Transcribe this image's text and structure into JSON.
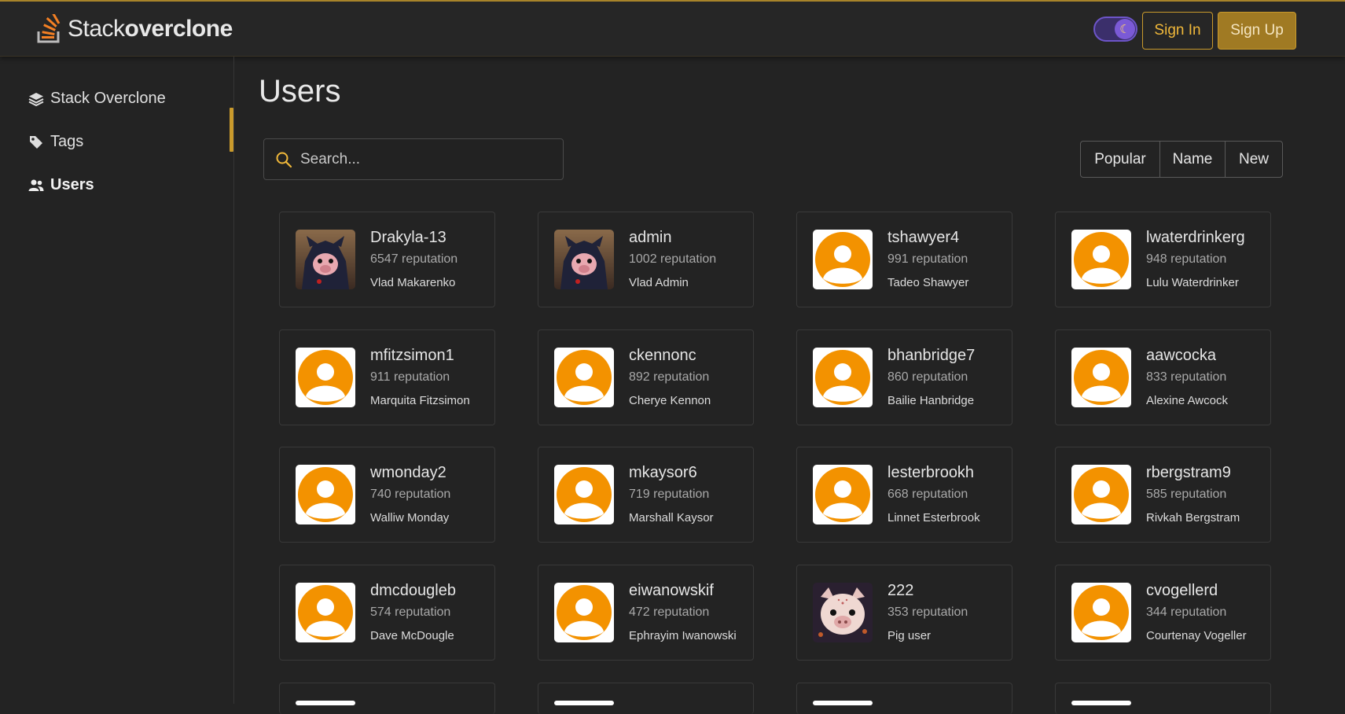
{
  "header": {
    "logo_light": "Stack",
    "logo_bold": "overclone",
    "theme_toggle_icon": "moon-icon",
    "sign_in": "Sign In",
    "sign_up": "Sign Up"
  },
  "sidebar": {
    "items": [
      {
        "label": "Stack Overclone",
        "icon": "layers-icon"
      },
      {
        "label": "Tags",
        "icon": "tags-icon"
      },
      {
        "label": "Users",
        "icon": "users-icon",
        "active": true
      }
    ]
  },
  "main": {
    "title": "Users",
    "search_placeholder": "Search...",
    "filters": [
      "Popular",
      "Name",
      "New"
    ]
  },
  "users": [
    {
      "username": "Drakyla-13",
      "reputation": "6547 reputation",
      "name": "Vlad Makarenko",
      "avatar": "hooded-pig"
    },
    {
      "username": "admin",
      "reputation": "1002 reputation",
      "name": "Vlad Admin",
      "avatar": "hooded-pig"
    },
    {
      "username": "tshawyer4",
      "reputation": "991 reputation",
      "name": "Tadeo Shawyer",
      "avatar": "default"
    },
    {
      "username": "lwaterdrinkerg",
      "reputation": "948 reputation",
      "name": "Lulu Waterdrinker",
      "avatar": "default"
    },
    {
      "username": "mfitzsimon1",
      "reputation": "911 reputation",
      "name": "Marquita Fitzsimon",
      "avatar": "default"
    },
    {
      "username": "ckennonc",
      "reputation": "892 reputation",
      "name": "Cherye Kennon",
      "avatar": "default"
    },
    {
      "username": "bhanbridge7",
      "reputation": "860 reputation",
      "name": "Bailie Hanbridge",
      "avatar": "default"
    },
    {
      "username": "aawcocka",
      "reputation": "833 reputation",
      "name": "Alexine Awcock",
      "avatar": "default"
    },
    {
      "username": "wmonday2",
      "reputation": "740 reputation",
      "name": "Walliw Monday",
      "avatar": "default"
    },
    {
      "username": "mkaysor6",
      "reputation": "719 reputation",
      "name": "Marshall Kaysor",
      "avatar": "default"
    },
    {
      "username": "lesterbrookh",
      "reputation": "668 reputation",
      "name": "Linnet Esterbrook",
      "avatar": "default"
    },
    {
      "username": "rbergstram9",
      "reputation": "585 reputation",
      "name": "Rivkah Bergstram",
      "avatar": "default"
    },
    {
      "username": "dmcdougleb",
      "reputation": "574 reputation",
      "name": "Dave McDougle",
      "avatar": "default"
    },
    {
      "username": "eiwanowskif",
      "reputation": "472 reputation",
      "name": "Ephrayim Iwanowski",
      "avatar": "default"
    },
    {
      "username": "222",
      "reputation": "353 reputation",
      "name": "Pig user",
      "avatar": "pig"
    },
    {
      "username": "cvogellerd",
      "reputation": "344 reputation",
      "name": "Courtenay Vogeller",
      "avatar": "default"
    }
  ],
  "colors": {
    "accent": "#c99a2c",
    "avatar_orange": "#f39200",
    "background": "#232323"
  }
}
